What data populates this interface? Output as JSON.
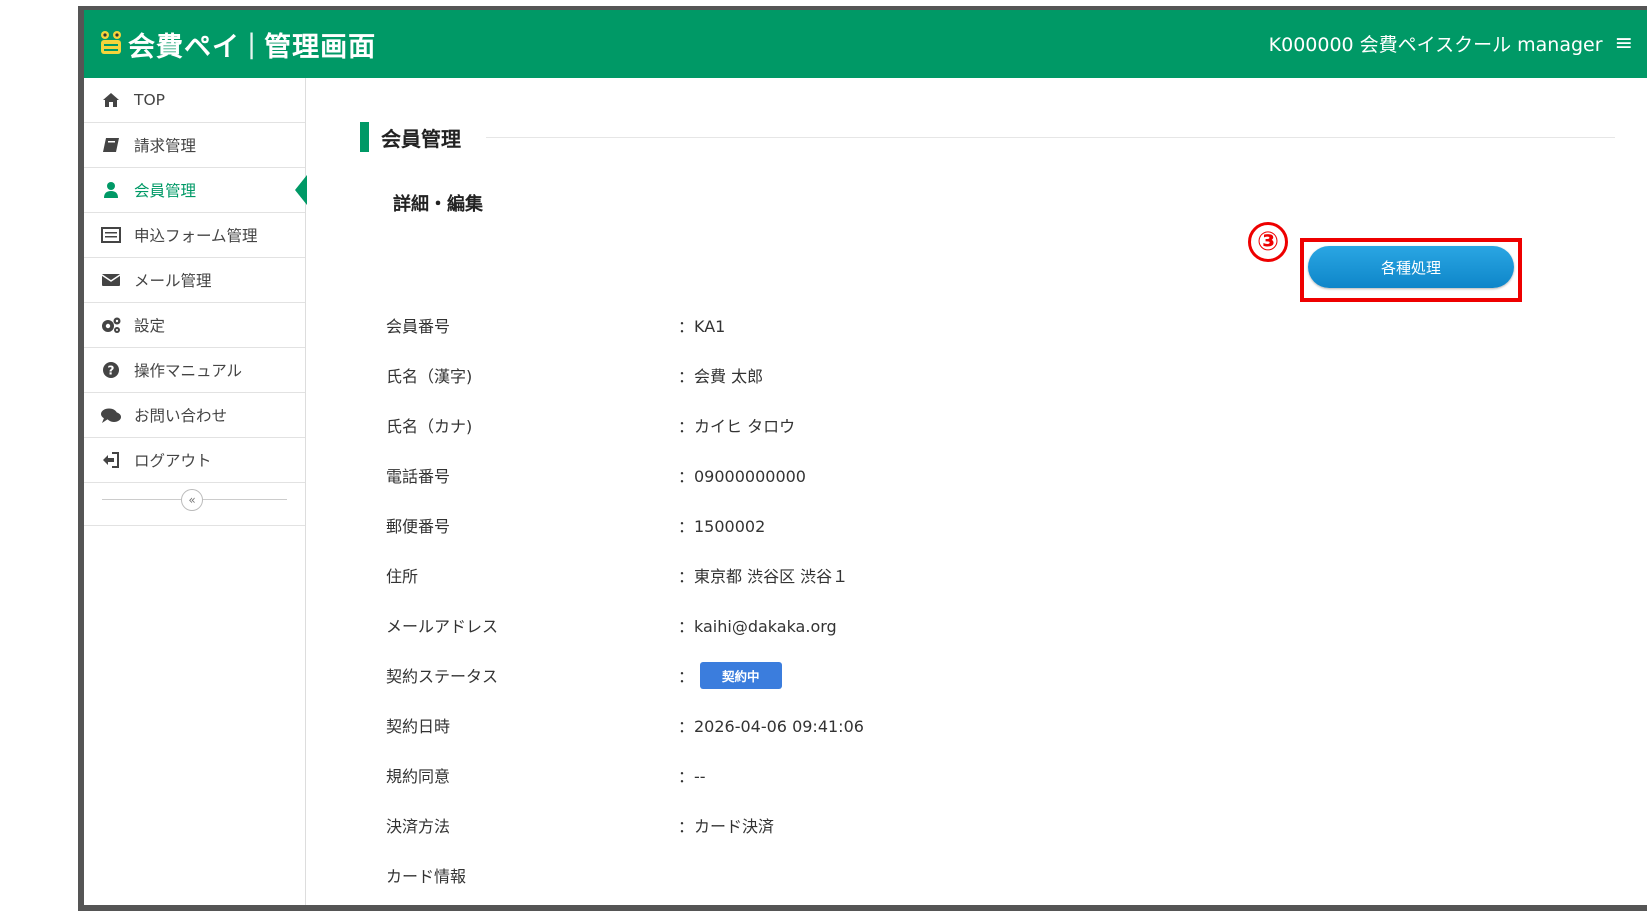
{
  "header": {
    "logo_text": "会費ペイ",
    "logo_separator": "|",
    "logo_subtitle": "管理画面",
    "account": "K000000 会費ペイスクール manager",
    "menu_icon": "hamburger-icon",
    "brand_color": "#009966"
  },
  "sidebar": {
    "items": [
      {
        "label": "TOP",
        "icon": "home-icon"
      },
      {
        "label": "請求管理",
        "icon": "book-icon"
      },
      {
        "label": "会員管理",
        "icon": "user-icon",
        "active": true
      },
      {
        "label": "申込フォーム管理",
        "icon": "list-icon"
      },
      {
        "label": "メール管理",
        "icon": "envelope-icon"
      },
      {
        "label": "設定",
        "icon": "gears-icon"
      },
      {
        "label": "操作マニュアル",
        "icon": "question-icon"
      },
      {
        "label": "お問い合わせ",
        "icon": "chat-icon"
      },
      {
        "label": "ログアウト",
        "icon": "logout-icon"
      }
    ],
    "collapse_label": "«"
  },
  "main": {
    "title": "会員管理",
    "subheading": "詳細・編集",
    "step_marker": "③",
    "action_button": "各種処理",
    "fields": [
      {
        "label": "会員番号",
        "value": "：KA1"
      },
      {
        "label": "氏名（漢字)",
        "value": "：会費 太郎"
      },
      {
        "label": "氏名（カナ)",
        "value": "：カイヒ タロウ"
      },
      {
        "label": "電話番号",
        "value": "：09000000000"
      },
      {
        "label": "郵便番号",
        "value": "：1500002"
      },
      {
        "label": "住所",
        "value": "：東京都 渋谷区 渋谷１"
      },
      {
        "label": "メールアドレス",
        "value": "：kaihi@dakaka.org"
      },
      {
        "label": "契約ステータス",
        "value": "：",
        "badge": "契約中"
      },
      {
        "label": "契約日時",
        "value": "：2026-04-06 09:41:06"
      },
      {
        "label": "規約同意",
        "value": "：--"
      },
      {
        "label": "決済方法",
        "value": "：カード決済"
      },
      {
        "label": "カード情報",
        "value": ""
      }
    ]
  }
}
